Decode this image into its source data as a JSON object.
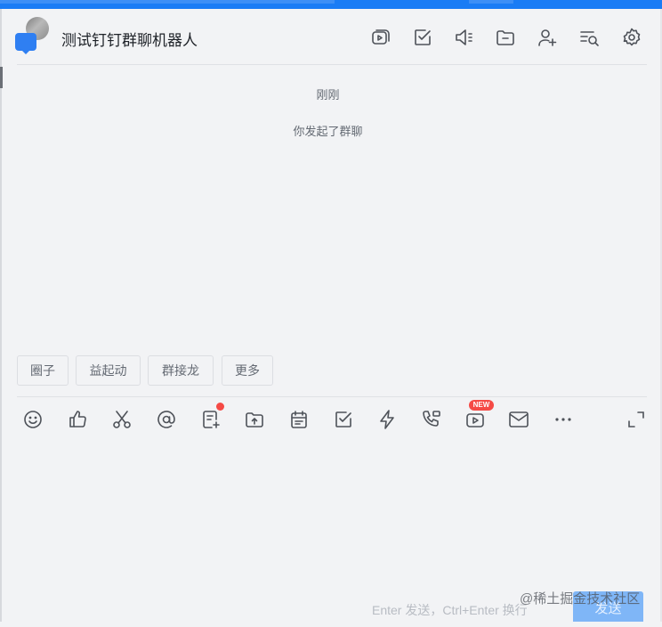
{
  "header": {
    "title": "测试钉钉群聊机器人",
    "icons": [
      "video-meeting-icon",
      "todo-check-icon",
      "announcement-icon",
      "folder-icon",
      "add-member-icon",
      "search-messages-icon",
      "settings-gear-icon"
    ]
  },
  "messages": {
    "time": "刚刚",
    "system": "你发起了群聊"
  },
  "quick_actions": [
    "圈子",
    "益起动",
    "群接龙",
    "更多"
  ],
  "toolbar": {
    "icons": [
      "emoji-icon",
      "like-icon",
      "screenshot-scissors-icon",
      "mention-at-icon",
      "doc-add-icon",
      "upload-file-icon",
      "calendar-icon",
      "todo-icon",
      "ding-lightning-icon",
      "call-icon",
      "live-video-icon",
      "email-icon",
      "more-dots-icon",
      "expand-icon"
    ],
    "new_badge": "NEW"
  },
  "input": {
    "hint": "Enter 发送，Ctrl+Enter 换行",
    "send_label": "发送"
  },
  "watermark": "@稀土掘金技术社区",
  "colors": {
    "accent": "#1a7cf5",
    "background": "#f2f3f5",
    "badge": "#f54a45"
  }
}
